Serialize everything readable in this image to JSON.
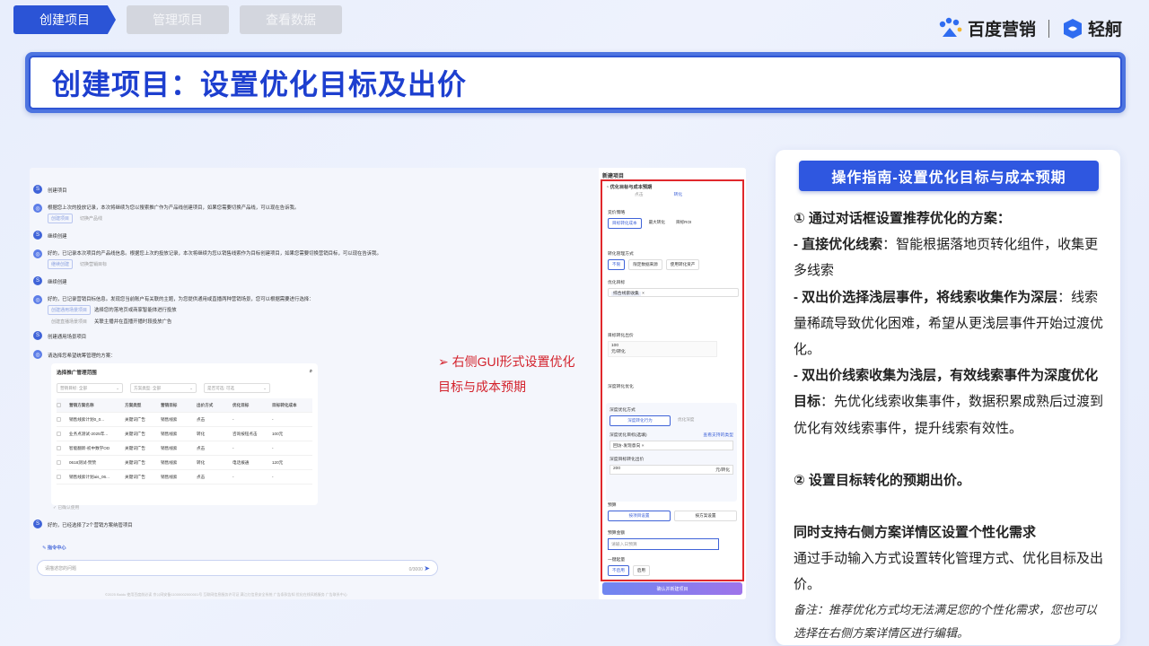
{
  "tabs": [
    "创建项目",
    "管理项目",
    "查看数据"
  ],
  "logos": {
    "baidu": "百度营销",
    "qingfan": "轻舸"
  },
  "title": "创建项目：设置优化目标及出价",
  "chat": {
    "m1": "创建项目",
    "m2": "根据您上次的投放记录，本次将继续为您以搜索推广作为产品线创建项目，如果您需要切换产品线，可以现在告诉我。",
    "m2_chips": [
      "创建项目",
      "切换产品线"
    ],
    "m3": "继续创建",
    "m4": "好的，已记录本次项目的产品线信息。根据您上次的投放记录，本次将继续为您以销售线索作为目标创建项目，如果您需要切换营销目标，可以现在告诉我。",
    "m4_chips": [
      "继续创建",
      "切换营销目标"
    ],
    "m5": "继续创建",
    "m6": "好的，已记录营销目标信息。发现您当前账户有关联的主题，为您提供通用或直播两种营销场景，您可以根据需要进行选择：",
    "m6_opt1": "选择您的落地页或商家智能体进行投放",
    "m6_opt2": "关联主播并在直播开播时段投放广告",
    "m6_chips": [
      "创建通用场景项目",
      "创建直播场景项目"
    ],
    "m7": "创建通用场景项目",
    "m8": "请选择您希望统筹管理的方案：",
    "table_title": "选择推广管理范围",
    "filters": [
      "营销目标: 全部",
      "方案类型: 全部",
      "是否可选: 可选"
    ],
    "columns": [
      "营销方案名称",
      "方案类型",
      "营销目标",
      "出价方式",
      "优化目标",
      "目标转化成本"
    ],
    "rows": [
      [
        "销售线索计划0_0...",
        "关键词广告",
        "销售线索",
        "点击",
        "-",
        "-"
      ],
      [
        "业务点测试-2025年...",
        "关键词广告",
        "销售线索",
        "转化",
        "咨询按钮点击",
        "100元"
      ],
      [
        "智能翻新-初中数学OD",
        "关键词广告",
        "销售线索",
        "点击",
        "-",
        "-"
      ],
      [
        "0618测试-赞赞",
        "关键词广告",
        "销售线索",
        "转化",
        "电话拨通",
        "120元"
      ],
      [
        "销售线索计划ais_06...",
        "关键词广告",
        "销售线索",
        "点击",
        "-",
        "-"
      ]
    ],
    "confirmed": "已确认使用",
    "m9": "好的，已经选择了2个营销方案纳管项目",
    "command_center": "指令中心",
    "input_placeholder": "请描述您的问题",
    "input_count": "0/3000",
    "footer": "©2025 Baidu 使用百度前必读 京公网安备11000002000001号 互联网信息服务许可证 满江红信息安全系统 广告条款告知 优化在线风格服务 广告联系中心"
  },
  "panel": {
    "title": "新建项目",
    "section": "优化目标与成本预期",
    "modes": [
      "点击",
      "转化"
    ],
    "bid_label": "竞价策略",
    "bid_opts": [
      "目标转化成本",
      "最大转化",
      "目标ROI"
    ],
    "conv_label": "转化管理方式",
    "conv_opts": [
      "不限",
      "限定数据来源",
      "使用转化资产"
    ],
    "goal_label": "优化目标",
    "goal_value": "综合线索收集",
    "target_label": "目标转化出价",
    "target_value": "100",
    "target_unit": "元/转化",
    "deep_label": "深度转化优化",
    "deep_mode_label": "深度优化方式",
    "deep_opts": [
      "深度转化行为",
      "优化深度"
    ],
    "deep_goal_label": "深度优化目标(选填)",
    "deep_goal_link": "查看支持的类型",
    "deep_goal_value": "回访-发现意向",
    "deep_bid_label": "深度目标转化出价",
    "deep_bid_value": "200",
    "deep_bid_unit": "元/转化",
    "budget_label": "预算",
    "budget_opts": [
      "按项目设置",
      "按方案设置"
    ],
    "budget_amount_label": "预算金额",
    "budget_placeholder": "请输入日预算",
    "onekey_label": "一键起量",
    "onekey_opts": [
      "不启用",
      "启用"
    ],
    "submit": "确认并新建项目"
  },
  "annotation": "➢ 右侧GUI形式设置优化目标与成本预期",
  "guide": {
    "header": "操作指南-设置优化目标与成本预期",
    "h1": "① 通过对话框设置推荐优化的方案：",
    "p1_bold": "- 直接优化线索",
    "p1_rest": "：智能根据落地页转化组件，收集更多线索",
    "p2_bold": "- 双出价选择浅层事件，将线索收集作为深层",
    "p2_rest": "：线索量稀疏导致优化困难，希望从更浅层事件开始过渡优化。",
    "p3_bold": "- 双出价线索收集为浅层，有效线索事件为深度优化目标",
    "p3_rest": "：先优化线索收集事件，数据积累成熟后过渡到优化有效线索事件，提升线索有效性。",
    "h2": "② 设置目标转化的预期出价。",
    "h3": "同时支持右侧方案详情区设置个性化需求",
    "p4": "通过手动输入方式设置转化管理方式、优化目标及出价。",
    "note": "备注：推荐优化方式均无法满足您的个性化需求，您也可以选择在右侧方案详情区进行编辑。"
  },
  "colors": {
    "accent": "#2b54d6",
    "annotation": "#d3212b",
    "redbox": "#e0282c"
  }
}
